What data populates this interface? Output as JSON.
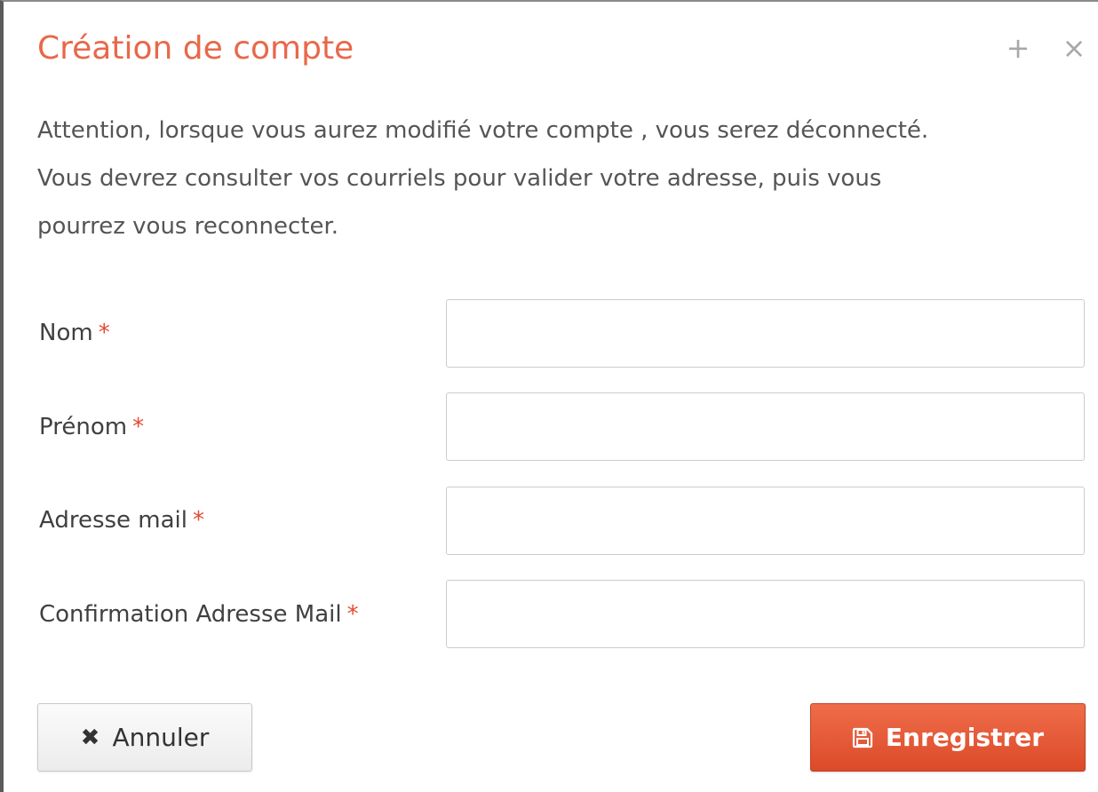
{
  "dialog": {
    "title": "Création de compte",
    "plus_glyph": "+",
    "close_glyph": "×",
    "message_lines": [
      "Attention, lorsque vous aurez modifié votre compte , vous serez déconnecté.",
      "Vous devrez consulter vos courriels pour valider votre adresse, puis vous",
      "pourrez vous reconnecter."
    ]
  },
  "form": {
    "required_mark": "*",
    "fields": [
      {
        "label": "Nom",
        "value": "",
        "placeholder": ""
      },
      {
        "label": "Prénom",
        "value": "",
        "placeholder": ""
      },
      {
        "label": "Adresse mail",
        "value": "",
        "placeholder": ""
      },
      {
        "label": "Confirmation Adresse Mail",
        "value": "",
        "placeholder": ""
      }
    ]
  },
  "buttons": {
    "cancel_label": "Annuler",
    "cancel_icon": "times-icon",
    "cancel_glyph": "✖",
    "save_label": "Enregistrer",
    "save_icon": "floppy-disk-icon"
  },
  "colors": {
    "title": "#e8684a",
    "accent": "#e24b32",
    "save_button": "#e5532f"
  }
}
